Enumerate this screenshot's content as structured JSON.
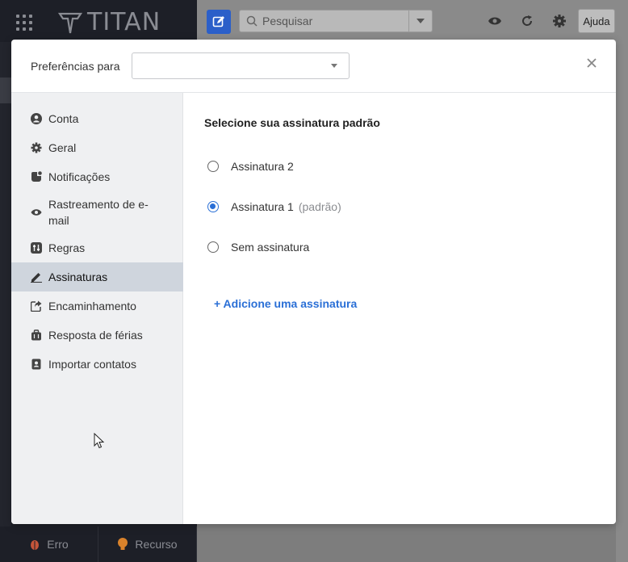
{
  "app": {
    "brand": "TITAN"
  },
  "topbar": {
    "search_placeholder": "Pesquisar",
    "help_label": "Ajuda"
  },
  "bottombar": {
    "error_label": "Erro",
    "feature_label": "Recurso"
  },
  "modal": {
    "header_label": "Preferências para",
    "selected_account": ""
  },
  "sidebar": {
    "items": [
      {
        "label": "Conta",
        "icon": "account-circle-icon"
      },
      {
        "label": "Geral",
        "icon": "gear-icon"
      },
      {
        "label": "Notificações",
        "icon": "notification-icon"
      },
      {
        "label": "Rastreamento de e-mail",
        "icon": "eye-icon"
      },
      {
        "label": "Regras",
        "icon": "rules-sliders-icon"
      },
      {
        "label": "Assinaturas",
        "icon": "pen-icon",
        "active": true
      },
      {
        "label": "Encaminhamento",
        "icon": "forward-share-icon"
      },
      {
        "label": "Resposta de férias",
        "icon": "suitcase-icon"
      },
      {
        "label": "Importar contatos",
        "icon": "contacts-icon"
      }
    ]
  },
  "signatures": {
    "heading": "Selecione sua assinatura padrão",
    "options": [
      {
        "label": "Assinatura 2",
        "suffix": "",
        "selected": false
      },
      {
        "label": "Assinatura 1",
        "suffix": "(padrão)",
        "selected": true
      },
      {
        "label": "Sem assinatura",
        "suffix": "",
        "selected": false
      }
    ],
    "add_label": "+ Adicione uma assinatura"
  },
  "colors": {
    "accent": "#2a6fd6",
    "active_nav": "#cfd5dd",
    "sidebar_bg": "#eff0f2"
  }
}
